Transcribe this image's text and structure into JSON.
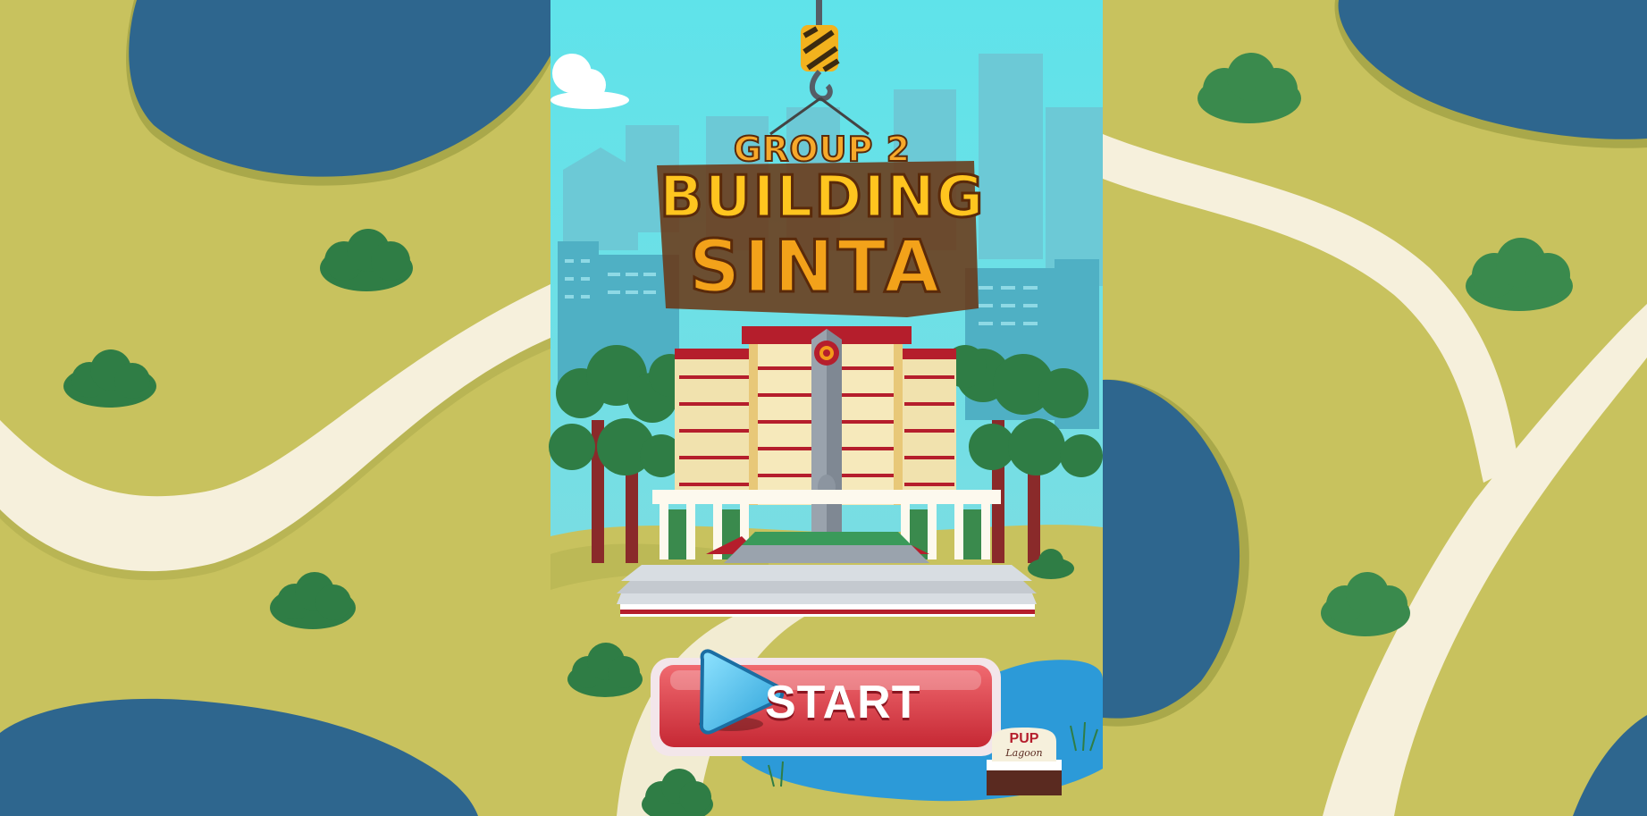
{
  "game": {
    "title_group": "GROUP 2",
    "title_line1": "BUILDING",
    "title_line2": "SINTA",
    "start_label": "START",
    "sign_line1": "PUP",
    "sign_line2": "Lagoon"
  },
  "colors": {
    "grass": "#c8c25e",
    "grass_dark": "#a9a84a",
    "water": "#2e668e",
    "path": "#f6f0dc",
    "sky_top": "#5fe0e8",
    "sky_bottom": "#7fd9de",
    "tree": "#3a8a4d",
    "title_orange": "#f39a1a",
    "title_outline": "#6b3410",
    "button_red": "#e0404a",
    "button_play": "#3fb8e8",
    "building_red": "#b51e2c",
    "building_cream": "#f1e2ae"
  }
}
